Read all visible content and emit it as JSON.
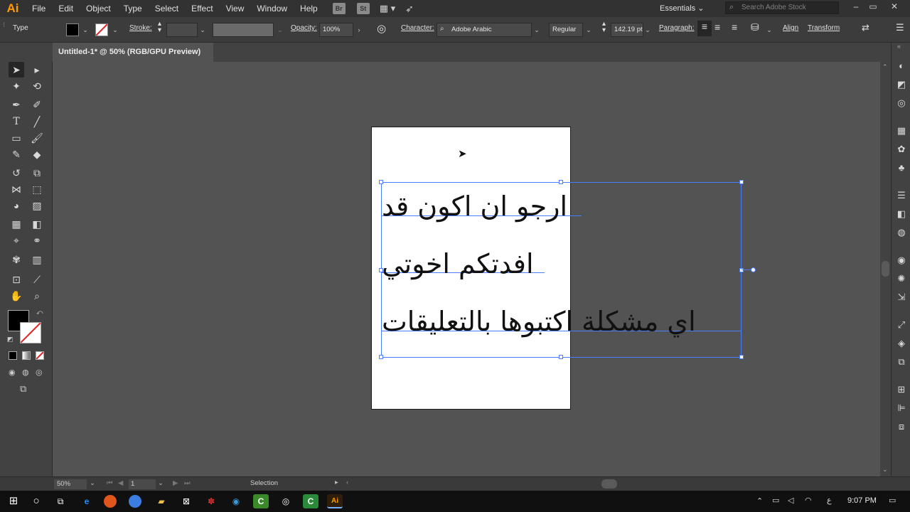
{
  "app": {
    "logo": "Ai",
    "bridge": "Br",
    "stock": "St"
  },
  "menu": [
    "File",
    "Edit",
    "Object",
    "Type",
    "Select",
    "Effect",
    "View",
    "Window",
    "Help"
  ],
  "workspace": "Essentials",
  "search": {
    "placeholder": "Search Adobe Stock"
  },
  "control": {
    "type_label": "Type",
    "stroke_label": "Stroke:",
    "opacity_label": "Opacity:",
    "opacity_value": "100%",
    "character_label": "Character:",
    "font_name": "Adobe Arabic",
    "font_style": "Regular",
    "font_size": "142.19 pt",
    "paragraph_label": "Paragraph:",
    "align_label": "Align",
    "transform_label": "Transform"
  },
  "document": {
    "tab_title": "Untitled-1* @ 50% (RGB/GPU Preview)",
    "close": "×"
  },
  "text_lines": [
    "ارجو ان اكون قد",
    "افدتكم اخوتي",
    "اي مشكلة اكتبوها بالتعليقات"
  ],
  "status": {
    "zoom": "50%",
    "artboard": "1",
    "tool": "Selection"
  },
  "taskbar": {
    "time": "9:07 PM",
    "lang": "ع"
  },
  "colors": {
    "accent": "#ff9a00",
    "selection": "#4a7cff"
  }
}
